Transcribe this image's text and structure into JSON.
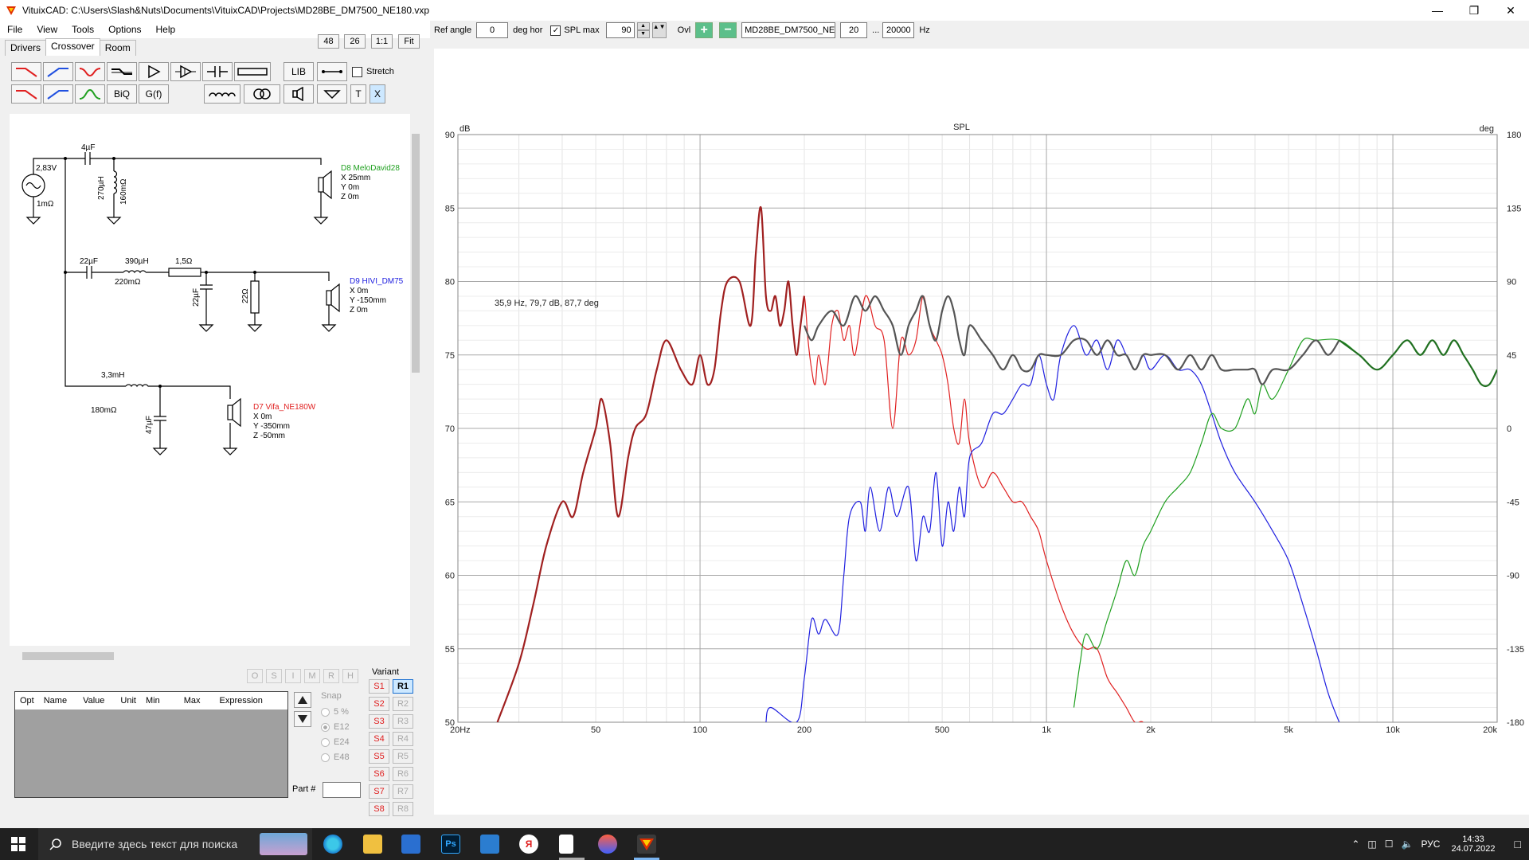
{
  "window": {
    "title": "VituixCAD: C:\\Users\\Slash&Nuts\\Documents\\VituixCAD\\Projects\\MD28BE_DM7500_NE180.vxp"
  },
  "menu": [
    "File",
    "View",
    "Tools",
    "Options",
    "Help"
  ],
  "tabs": [
    "Drivers",
    "Crossover",
    "Room"
  ],
  "zoom_buttons": [
    "48",
    "26",
    "1:1",
    "Fit"
  ],
  "toolbar": {
    "lib": "LIB",
    "stretch": "Stretch",
    "biq": "BiQ",
    "gf": "G(f)",
    "t": "T",
    "x": "X"
  },
  "schematic": {
    "source_voltage": "2,83V",
    "source_res": "1mΩ",
    "c1": "4µF",
    "l1": "270µH",
    "l1_res": "160mΩ",
    "d8_name": "D8 MeloDavid28",
    "d8_x": "X 25mm",
    "d8_y": "Y 0m",
    "d8_z": "Z 0m",
    "c2": "22µF",
    "l2": "390µH",
    "l2_res": "220mΩ",
    "r2": "1,5Ω",
    "c3": "22µF",
    "r3": "22Ω",
    "d9_name": "D9 HIVI_DM75",
    "d9_x": "X 0m",
    "d9_y": "Y -150mm",
    "d9_z": "Z 0m",
    "l3": "3,3mH",
    "l3_res": "180mΩ",
    "c4": "47µF",
    "d7_name": "D7 Vifa_NE180W",
    "d7_x": "X 0m",
    "d7_y": "Y -350mm",
    "d7_z": "Z -50mm"
  },
  "omh_buttons": [
    "O",
    "S",
    "I",
    "M",
    "R",
    "H"
  ],
  "opt_table": {
    "headers": [
      "Opt",
      "Name",
      "Value",
      "Unit",
      "Min",
      "Max",
      "Expression"
    ]
  },
  "snap": {
    "label": "Snap",
    "options": [
      "5 %",
      "E12",
      "E24",
      "E48"
    ],
    "selected": "E12"
  },
  "part_label": "Part #",
  "variant": {
    "label": "Variant",
    "s": [
      "S1",
      "S2",
      "S3",
      "S4",
      "S5",
      "S6",
      "S7",
      "S8"
    ],
    "r": [
      "R1",
      "R2",
      "R3",
      "R4",
      "R5",
      "R6",
      "R7",
      "R8"
    ]
  },
  "controls": {
    "ref_angle_label": "Ref angle",
    "ref_angle_value": "0",
    "deg_hor": "deg hor",
    "spl_max_label": "SPL max",
    "spl_max_value": "90",
    "ovl_label": "Ovl",
    "overlay_name": "MD28BE_DM7500_NE",
    "f_min": "20",
    "dots": "...",
    "f_max": "20000",
    "hz": "Hz"
  },
  "taskbar": {
    "search_placeholder": "Введите здесь текст для поиска",
    "lang": "РУС",
    "time": "14:33",
    "date": "24.07.2022"
  },
  "chart_data": {
    "type": "line",
    "title": "SPL",
    "ylabel": "dB",
    "y2label": "deg",
    "xscale": "log",
    "xlim": [
      20,
      20000
    ],
    "ylim": [
      50,
      90
    ],
    "y2lim": [
      -180,
      180
    ],
    "x_ticks": [
      "20Hz",
      "50",
      "100",
      "200",
      "500",
      "1k",
      "2k",
      "5k",
      "10k",
      "20k"
    ],
    "y_ticks": [
      "90",
      "85",
      "80",
      "75",
      "70",
      "65",
      "60",
      "55",
      "50"
    ],
    "y2_ticks": [
      "180",
      "135",
      "90",
      "45",
      "0",
      "-45",
      "-90",
      "-135",
      "-180"
    ],
    "annotation": "35,9 Hz, 79,7 dB, 87,7 deg",
    "colors": {
      "woofer": "#e02020",
      "mid": "#2020e0",
      "tweeter": "#20a020",
      "sum": "#555555",
      "low_sum": "#a02020",
      "high_sum": "#207020"
    },
    "series": [
      {
        "key": "woofer",
        "x": [
          26,
          30,
          33,
          36,
          40,
          43,
          46,
          50,
          52,
          55,
          58,
          62,
          65,
          70,
          75,
          80,
          88,
          95,
          100,
          105,
          110,
          115,
          120,
          130,
          140,
          145,
          150,
          155,
          160,
          165,
          170,
          175,
          180,
          185,
          190,
          195,
          200,
          205,
          210,
          215,
          220,
          230,
          240,
          250,
          260,
          270,
          280,
          300,
          320,
          340,
          360,
          380,
          400,
          420,
          440,
          460,
          480,
          500,
          520,
          540,
          560,
          580,
          600,
          650,
          700,
          750,
          800,
          850,
          900,
          950,
          1000,
          1100,
          1200,
          1300,
          1400,
          1500,
          1600,
          1700,
          1800,
          1900,
          2000
        ],
        "y": [
          50,
          54,
          58,
          62,
          65,
          64,
          67,
          70,
          72,
          69,
          64,
          68,
          70,
          71,
          74,
          76,
          74,
          73,
          75,
          73,
          74,
          78,
          80,
          80,
          77,
          82,
          85,
          79,
          78,
          79,
          77,
          78,
          80,
          77,
          75,
          77,
          79,
          76,
          74,
          73,
          75,
          73,
          77,
          78,
          76,
          77,
          75,
          79,
          77,
          76,
          70,
          76,
          75,
          76,
          79,
          77,
          76,
          75,
          73,
          70,
          69,
          72,
          69,
          66,
          67,
          66,
          65,
          65,
          64,
          63,
          61,
          58,
          56,
          55,
          55,
          53,
          52,
          51,
          50,
          50,
          49
        ]
      },
      {
        "key": "mid",
        "x": [
          155,
          160,
          190,
          200,
          210,
          220,
          230,
          250,
          260,
          270,
          290,
          300,
          310,
          330,
          350,
          370,
          400,
          420,
          440,
          460,
          480,
          500,
          520,
          540,
          560,
          580,
          600,
          650,
          700,
          750,
          800,
          850,
          900,
          950,
          1000,
          1050,
          1100,
          1200,
          1300,
          1400,
          1500,
          1600,
          1700,
          1800,
          1900,
          2000,
          2200,
          2400,
          2600,
          2800,
          3000,
          3200,
          3500,
          4000,
          4500,
          5000,
          5500,
          6000,
          6500,
          7000
        ],
        "y": [
          50,
          51,
          50,
          53,
          57,
          56,
          57,
          56,
          60,
          64,
          65,
          63,
          66,
          63,
          66,
          64,
          66,
          61,
          64,
          63,
          67,
          62,
          65,
          63,
          66,
          64,
          68,
          69,
          71,
          71,
          72,
          73,
          73,
          75,
          73,
          72,
          75,
          77,
          75,
          76,
          74,
          76,
          75,
          74,
          75,
          74,
          75,
          74,
          74,
          73,
          71,
          69,
          67,
          65,
          63,
          61,
          58,
          55,
          52,
          50
        ]
      },
      {
        "key": "tweeter",
        "x": [
          1200,
          1250,
          1300,
          1400,
          1500,
          1600,
          1700,
          1800,
          1900,
          2000,
          2200,
          2400,
          2600,
          2800,
          3000,
          3200,
          3500,
          3800,
          4000,
          4200,
          4500,
          5000,
          5500,
          6000,
          7000,
          8000,
          9000,
          10000,
          11000,
          12000,
          13000,
          14000,
          15000,
          16000,
          17000,
          18000,
          19000,
          20000
        ],
        "y": [
          51,
          54,
          56,
          55,
          57,
          59,
          61,
          60,
          62,
          63,
          65,
          66,
          67,
          69,
          71,
          70,
          70,
          72,
          71,
          73,
          72,
          74,
          76,
          76,
          76,
          75,
          74,
          75,
          76,
          75,
          76,
          75,
          76,
          75,
          74,
          73,
          73,
          74
        ]
      },
      {
        "key": "sum",
        "x": [
          200,
          210,
          220,
          240,
          260,
          280,
          300,
          320,
          340,
          360,
          380,
          400,
          420,
          440,
          460,
          480,
          500,
          520,
          540,
          560,
          580,
          600,
          650,
          700,
          750,
          800,
          850,
          900,
          950,
          1000,
          1100,
          1200,
          1300,
          1400,
          1500,
          1600,
          1700,
          1800,
          1900,
          2000,
          2200,
          2400,
          2600,
          2800,
          3000,
          3200,
          3500,
          3800,
          4000,
          4200,
          4500,
          5000,
          5500,
          6000,
          6500,
          7000
        ],
        "y": [
          77,
          76,
          77,
          78,
          77,
          79,
          78,
          79,
          78,
          77,
          75,
          77,
          78,
          79,
          77,
          76,
          78,
          79,
          78,
          76,
          75,
          77,
          76,
          75,
          74,
          75,
          74,
          74,
          75,
          75,
          75,
          76,
          76,
          75,
          76,
          75,
          75,
          74,
          75,
          75,
          75,
          74,
          75,
          74,
          75,
          74,
          74,
          74,
          74,
          73,
          74,
          74,
          75,
          76,
          75,
          76
        ]
      }
    ]
  }
}
